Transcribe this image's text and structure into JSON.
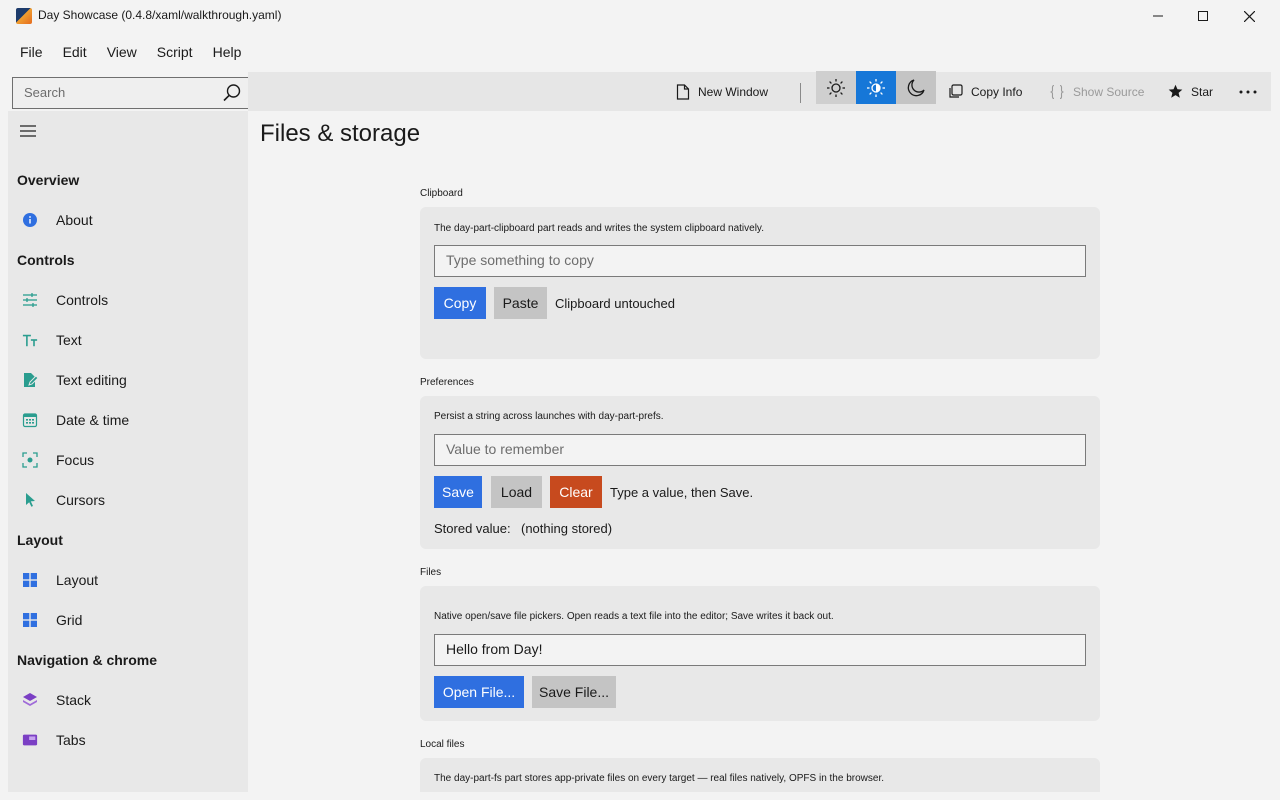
{
  "window": {
    "title": "Day Showcase (0.4.8/xaml/walkthrough.yaml)",
    "app_icon": "app-logo-icon",
    "controls": [
      "minimize-icon",
      "maximize-icon",
      "close-icon"
    ]
  },
  "menu": [
    "File",
    "Edit",
    "View",
    "Script",
    "Help"
  ],
  "search": {
    "placeholder": "Search",
    "icon": "search-icon"
  },
  "toolbar": {
    "new_window": "New Window",
    "copy_info": "Copy Info",
    "show_source": "Show Source",
    "star": "Star",
    "theme_buttons": [
      "light-theme-icon",
      "auto-theme-icon",
      "dark-theme-icon"
    ],
    "active_theme": "auto",
    "accent": "#1677d8"
  },
  "sidebar": {
    "groups": [
      {
        "header": "Overview",
        "items": [
          {
            "label": "About",
            "icon": "info-icon"
          }
        ]
      },
      {
        "header": "Controls",
        "items": [
          {
            "label": "Controls",
            "icon": "sliders-icon"
          },
          {
            "label": "Text",
            "icon": "text-icon"
          },
          {
            "label": "Text editing",
            "icon": "edit-document-icon"
          },
          {
            "label": "Date & time",
            "icon": "calendar-icon"
          },
          {
            "label": "Focus",
            "icon": "focus-icon"
          },
          {
            "label": "Cursors",
            "icon": "cursor-icon"
          }
        ]
      },
      {
        "header": "Layout",
        "items": [
          {
            "label": "Layout",
            "icon": "layout-icon"
          },
          {
            "label": "Grid",
            "icon": "grid-icon"
          }
        ]
      },
      {
        "header": "Navigation & chrome",
        "items": [
          {
            "label": "Stack",
            "icon": "stack-icon"
          },
          {
            "label": "Tabs",
            "icon": "tabs-icon"
          }
        ]
      }
    ]
  },
  "page": {
    "title": "Files & storage",
    "clipboard": {
      "label": "Clipboard",
      "desc": "The day-part-clipboard part reads and writes the system clipboard natively.",
      "placeholder": "Type something to copy",
      "copy": "Copy",
      "paste": "Paste",
      "status": "Clipboard untouched"
    },
    "preferences": {
      "label": "Preferences",
      "desc": "Persist a string across launches with day-part-prefs.",
      "placeholder": "Value to remember",
      "save": "Save",
      "load": "Load",
      "clear": "Clear",
      "status": "Type a value, then Save.",
      "stored_label": "Stored value:",
      "stored_value": "(nothing stored)"
    },
    "files": {
      "label": "Files",
      "desc": "Native open/save file pickers. Open reads a text file into the editor; Save writes it back out.",
      "value": "Hello from Day!",
      "open": "Open File...",
      "save": "Save File..."
    },
    "local_files": {
      "label": "Local files",
      "desc": "The day-part-fs part stores app-private files on every target — real files natively, OPFS in the browser."
    }
  }
}
